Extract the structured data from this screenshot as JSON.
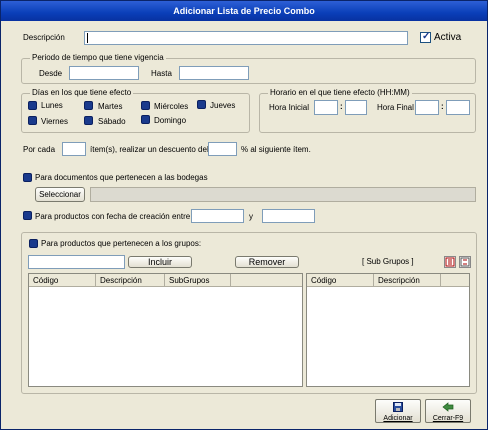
{
  "window": {
    "title": "Adicionar Lista de Precio Combo"
  },
  "descripcion": {
    "label": "Descripción",
    "value": ""
  },
  "activa": {
    "label": "Activa",
    "checked": true
  },
  "periodo": {
    "title": "Periodo de tiempo que tiene vigencia",
    "desde_label": "Desde",
    "hasta_label": "Hasta",
    "desde_value": "",
    "hasta_value": ""
  },
  "dias": {
    "title": "Días en los que tiene efecto",
    "items": [
      "Lunes",
      "Martes",
      "Miércoles",
      "Jueves",
      "Viernes",
      "Sábado",
      "Domingo"
    ]
  },
  "horario": {
    "title": "Horario en el que tiene efecto   (HH:MM)",
    "inicial_label": "Hora Inicial",
    "final_label": "Hora Final",
    "sep": ":"
  },
  "descuento": {
    "por_cada": "Por cada",
    "items_text": "ítem(s), realizar un descuento  del",
    "pct_text": "% al siguiente ítem."
  },
  "bodegas": {
    "label": "Para documentos que pertenecen a las bodegas",
    "button": "Seleccionar"
  },
  "fecha": {
    "label": "Para productos con fecha de creación entre",
    "y": "y"
  },
  "grupos": {
    "label": "Para productos que pertenecen a los grupos:",
    "incluir": "Incluir",
    "remover": "Remover",
    "sub_grupos": "[ Sub Grupos ]",
    "left_columns": [
      "Código",
      "Descripción",
      "SubGrupos"
    ],
    "right_columns": [
      "Código",
      "Descripción"
    ]
  },
  "footer": {
    "adicionar": "Adicionar",
    "cerrar": "Cerrar-F9"
  },
  "colors": {
    "titlebar": "#0a3fb8",
    "checkbox": "#1a3a8c"
  }
}
